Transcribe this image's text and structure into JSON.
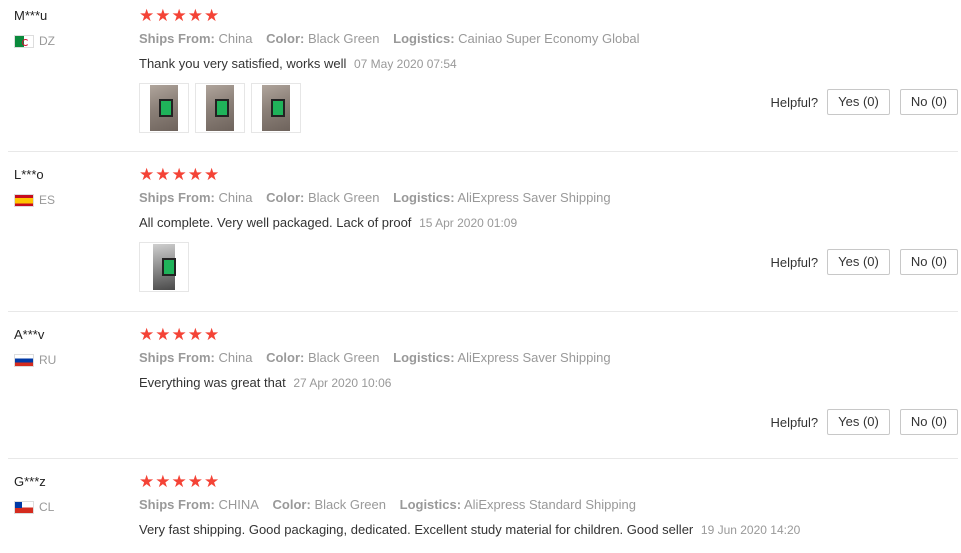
{
  "labels": {
    "ships_from": "Ships From:",
    "color": "Color:",
    "logistics": "Logistics:",
    "helpful": "Helpful?"
  },
  "reviews": [
    {
      "user": "M***u",
      "country": "DZ",
      "flag": "flag-dz-icon",
      "rating": 5,
      "ships_from": "China",
      "color": "Black Green",
      "logistics": "Cainiao Super Economy Global",
      "text": "Thank you very satisfied, works well",
      "date": "07 May 2020 07:54",
      "photos": 3,
      "yes": "Yes (0)",
      "no": "No (0)"
    },
    {
      "user": "L***o",
      "country": "ES",
      "flag": "flag-es-icon",
      "rating": 5,
      "ships_from": "China",
      "color": "Black Green",
      "logistics": "AliExpress Saver Shipping",
      "text": "All complete. Very well packaged. Lack of proof",
      "date": "15 Apr 2020 01:09",
      "photos": 1,
      "yes": "Yes (0)",
      "no": "No (0)"
    },
    {
      "user": "A***v",
      "country": "RU",
      "flag": "flag-ru-icon",
      "rating": 5,
      "ships_from": "China",
      "color": "Black Green",
      "logistics": "AliExpress Saver Shipping",
      "text": "Everything was great that",
      "date": "27 Apr 2020 10:06",
      "photos": 0,
      "yes": "Yes (0)",
      "no": "No (0)"
    },
    {
      "user": "G***z",
      "country": "CL",
      "flag": "flag-cl-icon",
      "rating": 5,
      "ships_from": "CHINA",
      "color": "Black Green",
      "logistics": "AliExpress Standard Shipping",
      "text": "Very fast shipping. Good packaging, dedicated. Excellent study material for children. Good seller",
      "date": "19 Jun 2020 14:20",
      "photos": 0
    }
  ],
  "colors": {
    "star": "#f44336",
    "muted": "#999999",
    "divider": "#e8e8e8"
  }
}
